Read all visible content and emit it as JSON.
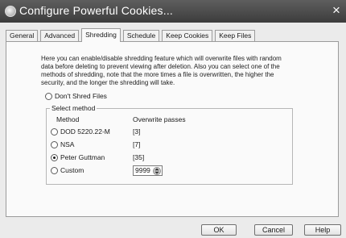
{
  "window": {
    "title": "Configure Powerful Cookies...",
    "close_glyph": "×"
  },
  "tabs": [
    {
      "label": "General",
      "active": false
    },
    {
      "label": "Advanced",
      "active": false
    },
    {
      "label": "Shredding",
      "active": true
    },
    {
      "label": "Schedule",
      "active": false
    },
    {
      "label": "Keep Cookies",
      "active": false
    },
    {
      "label": "Keep Files",
      "active": false
    }
  ],
  "description": "Here you can enable/disable shredding feature which will overwrite files with random data before deleting to prevent viewing after deletion. Also you can select one of the methods of shredding, note that the more times a file is overwritten, the higher the security, and the longer the shredding will take.",
  "dont_shred": {
    "label": "Don't Shred Files",
    "checked": false
  },
  "select_method": {
    "legend": "Select method",
    "col_method": "Method",
    "col_passes": "Overwrite passes",
    "methods": [
      {
        "label": "DOD 5220.22-M",
        "passes": "[3]",
        "checked": false
      },
      {
        "label": "NSA",
        "passes": "[7]",
        "checked": false
      },
      {
        "label": "Peter Guttman",
        "passes": "[35]",
        "checked": true
      },
      {
        "label": "Custom",
        "passes": "",
        "checked": false
      }
    ],
    "custom_value": "9999"
  },
  "buttons": {
    "ok": "OK",
    "cancel": "Cancel",
    "help": "Help"
  },
  "icons": {
    "app": "cookie-app-icon",
    "close": "close-icon",
    "spin": "spin-updown-icon"
  }
}
